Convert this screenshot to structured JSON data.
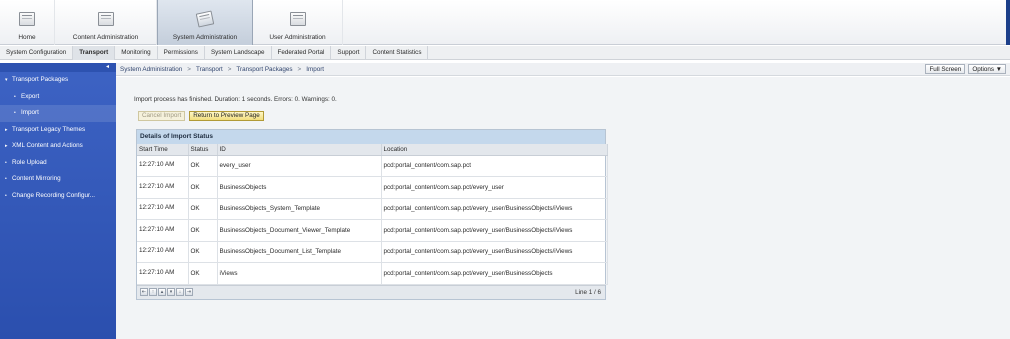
{
  "top_nav": [
    {
      "label": "Home",
      "icon": "home-folder-icon",
      "active": false
    },
    {
      "label": "Content Administration",
      "icon": "content-admin-folder-icon",
      "active": false
    },
    {
      "label": "System Administration",
      "icon": "system-admin-folder-icon",
      "active": true
    },
    {
      "label": "User Administration",
      "icon": "user-admin-folder-icon",
      "active": false
    }
  ],
  "sub_nav": [
    {
      "label": "System Configuration",
      "active": false
    },
    {
      "label": "Transport",
      "active": true
    },
    {
      "label": "Monitoring",
      "active": false
    },
    {
      "label": "Permissions",
      "active": false
    },
    {
      "label": "System Landscape",
      "active": false
    },
    {
      "label": "Federated Portal",
      "active": false
    },
    {
      "label": "Support",
      "active": false
    },
    {
      "label": "Content Statistics",
      "active": false
    }
  ],
  "sidebar": {
    "collapse_icon": "◂",
    "items": [
      {
        "label": "Transport Packages",
        "marker": "▾"
      },
      {
        "label": "Export",
        "marker": "•"
      },
      {
        "label": "Import",
        "marker": "•"
      },
      {
        "label": "Transport Legacy Themes",
        "marker": "▸"
      },
      {
        "label": "XML Content and Actions",
        "marker": "▸"
      },
      {
        "label": "Role Upload",
        "marker": "•"
      },
      {
        "label": "Content Mirroring",
        "marker": "•"
      },
      {
        "label": "Change Recording Configur...",
        "marker": "•"
      }
    ]
  },
  "breadcrumb": [
    "System Administration",
    "Transport",
    "Transport Packages",
    "Import"
  ],
  "breadcrumb_separator": ">",
  "tools": {
    "full_screen": "Full Screen",
    "options": "Options ▼"
  },
  "message": "Import process has finished. Duration: 1 seconds. Errors: 0. Warnings: 0.",
  "buttons": {
    "cancel_import": "Cancel Import",
    "return_preview": "Return to Preview Page"
  },
  "table": {
    "title": "Details of Import Status",
    "columns": [
      "Start Time",
      "Status",
      "ID",
      "Location"
    ],
    "rows": [
      {
        "start_time": "12:27:10 AM",
        "status": "OK",
        "id": "every_user",
        "location": "pcd:portal_content/com.sap.pct"
      },
      {
        "start_time": "12:27:10 AM",
        "status": "OK",
        "id": "BusinessObjects",
        "location": "pcd:portal_content/com.sap.pct/every_user"
      },
      {
        "start_time": "12:27:10 AM",
        "status": "OK",
        "id": "BusinessObjects_System_Template",
        "location": "pcd:portal_content/com.sap.pct/every_user/BusinessObjects/iViews"
      },
      {
        "start_time": "12:27:10 AM",
        "status": "OK",
        "id": "BusinessObjects_Document_Viewer_Template",
        "location": "pcd:portal_content/com.sap.pct/every_user/BusinessObjects/iViews"
      },
      {
        "start_time": "12:27:10 AM",
        "status": "OK",
        "id": "BusinessObjects_Document_List_Template",
        "location": "pcd:portal_content/com.sap.pct/every_user/BusinessObjects/iViews"
      },
      {
        "start_time": "12:27:10 AM",
        "status": "OK",
        "id": "iViews",
        "location": "pcd:portal_content/com.sap.pct/every_user/BusinessObjects"
      }
    ],
    "pager": [
      {
        "glyph": "⇤",
        "icon": "first-page-icon"
      },
      {
        "glyph": "↑",
        "icon": "page-up-icon"
      },
      {
        "glyph": "▴",
        "icon": "row-up-icon"
      },
      {
        "glyph": "▾",
        "icon": "row-down-icon"
      },
      {
        "glyph": "↓",
        "icon": "page-down-icon"
      },
      {
        "glyph": "⇥",
        "icon": "last-page-icon"
      }
    ],
    "line_info": "Line 1 / 6"
  },
  "colors": {
    "sidebar_blue": "#2f55b5",
    "table_header_blue": "#c4d8ec",
    "button_yellow": "#f1dd7c",
    "accent_edge": "#1c3f8a"
  }
}
